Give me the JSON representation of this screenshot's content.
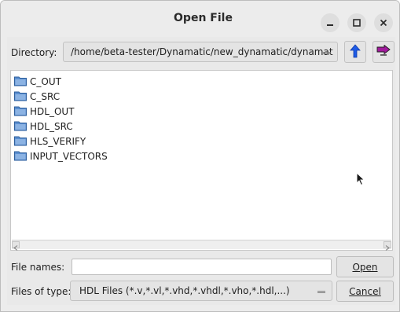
{
  "window": {
    "title": "Open File",
    "controls": {
      "minimize_icon": "minimize-icon",
      "maximize_icon": "maximize-icon",
      "close_icon": "close-icon"
    }
  },
  "directory": {
    "label": "Directory:",
    "path": "/home/beta-tester/Dynamatic/new_dynamatic/dynamat",
    "up_icon": "arrow-up-icon",
    "recent_icon": "recent-directories-icon"
  },
  "files": [
    {
      "name": "C_OUT",
      "icon": "folder-icon"
    },
    {
      "name": "C_SRC",
      "icon": "folder-icon"
    },
    {
      "name": "HDL_OUT",
      "icon": "folder-icon"
    },
    {
      "name": "HDL_SRC",
      "icon": "folder-icon"
    },
    {
      "name": "HLS_VERIFY",
      "icon": "folder-icon"
    },
    {
      "name": "INPUT_VECTORS",
      "icon": "folder-icon"
    }
  ],
  "file_names": {
    "label": "File names:",
    "value": ""
  },
  "file_type": {
    "label": "Files of type:",
    "selected": "HDL Files (*.v,*.vl,*.vhd,*.vhdl,*.vho,*.hdl,...)"
  },
  "buttons": {
    "open": "Open",
    "cancel": "Cancel"
  },
  "colors": {
    "folder": "#5b8fd0",
    "up_arrow": "#1e5be6",
    "recent_arrow": "#a11a9c"
  }
}
